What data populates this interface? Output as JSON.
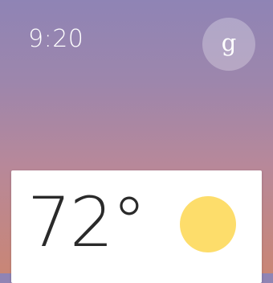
{
  "watch": {
    "time": "9:20",
    "assistant_letter": "g"
  },
  "weather_card": {
    "temperature": "72°",
    "condition_icon": "sun-icon"
  },
  "colors": {
    "gradient_top": "#8f84b5",
    "gradient_bottom": "#c98676",
    "sun": "#fddd6b",
    "card": "#ffffff"
  }
}
